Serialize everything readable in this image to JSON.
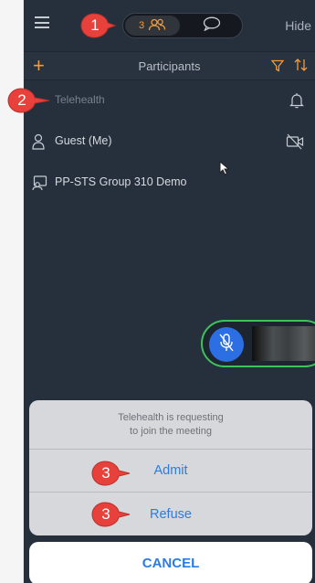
{
  "header": {
    "participant_count": "3",
    "people_icon": "people-icon",
    "chat_icon": "chat-bubble-icon",
    "hide_label": "Hide"
  },
  "toolbar": {
    "add_icon": "plus-icon",
    "title": "Participants",
    "filter_icon": "filter-icon",
    "sort_icon": "sort-icon"
  },
  "participants": [
    {
      "name": "Telehealth",
      "left_icon": "",
      "right_icon": "bell-icon",
      "state": "waiting"
    },
    {
      "name": "Guest (Me)",
      "left_icon": "person-icon",
      "right_icon": "camera-off-icon",
      "state": "joined"
    },
    {
      "name": "PP-STS Group 310 Demo",
      "left_icon": "room-system-icon",
      "right_icon": "",
      "state": "joined"
    }
  ],
  "video": {
    "mic_icon": "mic-muted-icon"
  },
  "dialog": {
    "message_line1": "Telehealth is requesting",
    "message_line2": "to join the meeting",
    "admit_label": "Admit",
    "refuse_label": "Refuse",
    "cancel_label": "CANCEL"
  },
  "callouts": {
    "one": "1",
    "two": "2",
    "three_admit": "3",
    "three_refuse": "3"
  },
  "colors": {
    "accent_orange": "#f19a3e",
    "action_blue": "#2c7be5",
    "callout_red": "#e8413c",
    "active_green": "#3fc15d",
    "panel_bg": "#26303d"
  }
}
